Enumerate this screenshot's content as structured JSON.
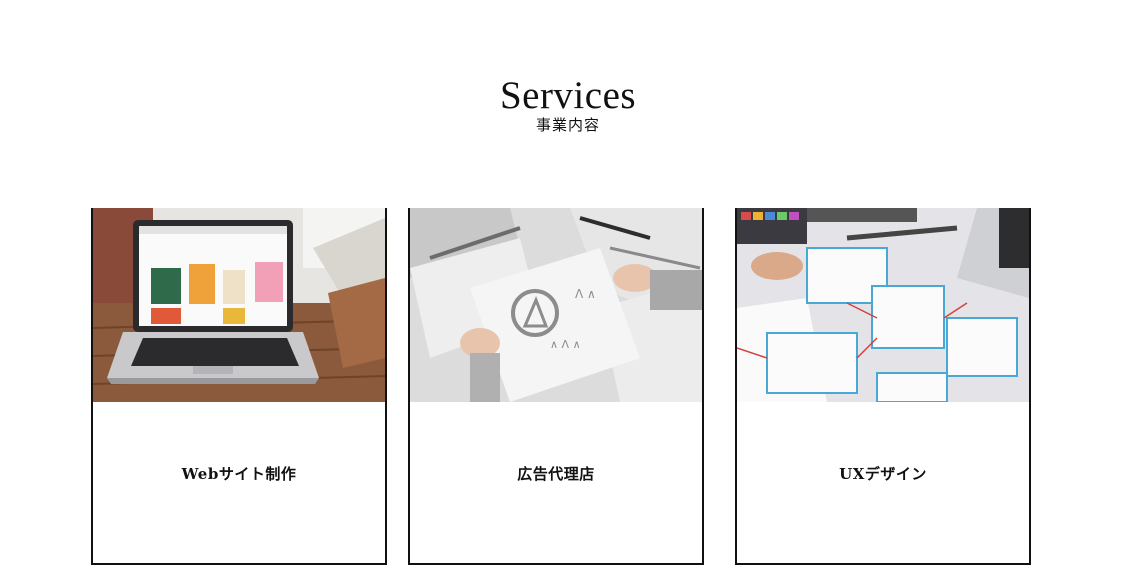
{
  "section": {
    "title": "Services",
    "subtitle": "事業内容"
  },
  "cards": [
    {
      "label": "Webサイト制作",
      "image": "laptop-on-wooden-desk-photo"
    },
    {
      "label": "広告代理店",
      "image": "logo-sketch-papers-photo"
    },
    {
      "label": "UXデザイン",
      "image": "ux-wireframe-sketches-photo"
    }
  ]
}
